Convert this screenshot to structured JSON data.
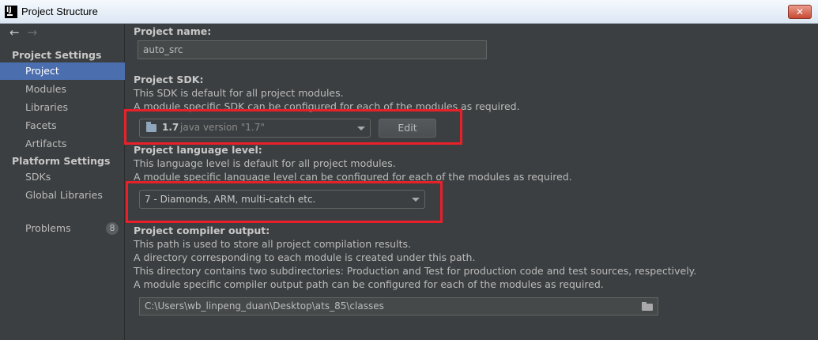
{
  "window": {
    "title": "Project Structure",
    "icon_label": "IJ",
    "close_glyph": "✕"
  },
  "nav": {
    "back": "←",
    "forward": "→"
  },
  "sidebar": {
    "project_settings_header": "Project Settings",
    "project_settings_items": [
      {
        "label": "Project",
        "selected": true
      },
      {
        "label": "Modules"
      },
      {
        "label": "Libraries"
      },
      {
        "label": "Facets"
      },
      {
        "label": "Artifacts"
      }
    ],
    "platform_settings_header": "Platform Settings",
    "platform_settings_items": [
      {
        "label": "SDKs"
      },
      {
        "label": "Global Libraries"
      }
    ],
    "problems": {
      "label": "Problems",
      "count": "8"
    }
  },
  "main": {
    "project_name": {
      "label": "Project name:",
      "value": "auto_src"
    },
    "project_sdk": {
      "label": "Project SDK:",
      "desc1": "This SDK is default for all project modules.",
      "desc2": "A module specific SDK can be configured for each of the modules as required.",
      "selected_name": "1.7",
      "selected_version": "java version \"1.7\"",
      "edit_label": "Edit"
    },
    "language_level": {
      "label": "Project language level:",
      "desc1": "This language level is default for all project modules.",
      "desc2": "A module specific language level can be configured for each of the modules as required.",
      "selected": "7 - Diamonds, ARM, multi-catch etc."
    },
    "compiler_output": {
      "label": "Project compiler output:",
      "desc1": "This path is used to store all project compilation results.",
      "desc2": "A directory corresponding to each module is created under this path.",
      "desc3": "This directory contains two subdirectories: Production and Test for production code and test sources, respectively.",
      "desc4": "A module specific compiler output path can be configured for each of the modules as required.",
      "path": "C:\\Users\\wb_linpeng_duan\\Desktop\\ats_85\\classes"
    }
  },
  "colors": {
    "background": "#3c3f41",
    "selection": "#4b6eaf",
    "highlight_box": "#e8202a"
  }
}
